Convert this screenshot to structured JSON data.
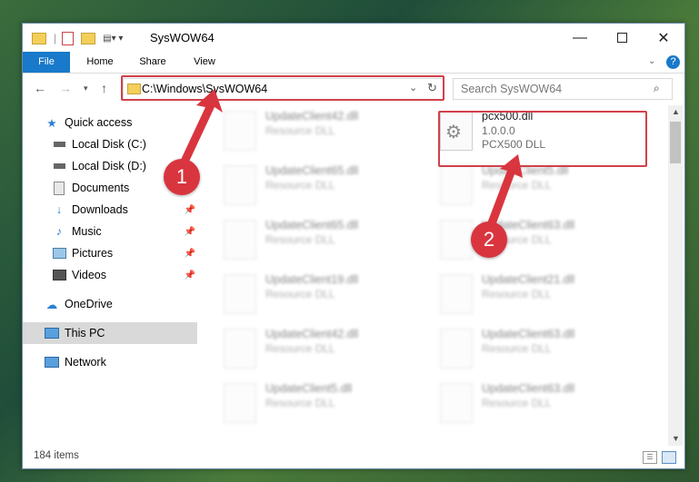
{
  "window": {
    "title": "SysWOW64"
  },
  "ribbon": {
    "tabs": [
      "File",
      "Home",
      "Share",
      "View"
    ]
  },
  "address": {
    "path": "C:\\Windows\\SysWOW64"
  },
  "search": {
    "placeholder": "Search SysWOW64"
  },
  "nav": {
    "items": [
      {
        "label": "Quick access",
        "icon": "star-icon"
      },
      {
        "label": "Local Disk (C:)",
        "icon": "drive-icon"
      },
      {
        "label": "Local Disk (D:)",
        "icon": "drive-icon"
      },
      {
        "label": "Documents",
        "icon": "documents-icon"
      },
      {
        "label": "Downloads",
        "icon": "download-icon"
      },
      {
        "label": "Music",
        "icon": "music-icon"
      },
      {
        "label": "Pictures",
        "icon": "pictures-icon"
      },
      {
        "label": "Videos",
        "icon": "videos-icon"
      },
      {
        "label": "OneDrive",
        "icon": "cloud-icon"
      },
      {
        "label": "This PC",
        "icon": "computer-icon"
      },
      {
        "label": "Network",
        "icon": "network-icon"
      }
    ]
  },
  "files": {
    "highlight": {
      "name": "pcx500.dll",
      "version": "1.0.0.0",
      "desc": "PCX500 DLL"
    },
    "left": [
      {
        "name": "UpdateClient42.dll",
        "desc": "Resource DLL"
      },
      {
        "name": "UpdateClient65.dll",
        "desc": "Resource DLL"
      },
      {
        "name": "UpdateClient65.dll",
        "desc": "Resource DLL"
      },
      {
        "name": "UpdateClient19.dll",
        "desc": "Resource DLL"
      },
      {
        "name": "UpdateClient42.dll",
        "desc": "Resource DLL"
      },
      {
        "name": "UpdateClient5.dll",
        "desc": "Resource DLL"
      }
    ],
    "right": [
      {
        "name": "UpdateClient5.dll",
        "desc": "Resource DLL"
      },
      {
        "name": "UpdateClient63.dll",
        "desc": "Resource DLL"
      },
      {
        "name": "UpdateClient21.dll",
        "desc": "Resource DLL"
      },
      {
        "name": "UpdateClient63.dll",
        "desc": "Resource DLL"
      },
      {
        "name": "UpdateClient63.dll",
        "desc": "Resource DLL"
      }
    ]
  },
  "status": {
    "count": "184 items"
  },
  "callouts": [
    "1",
    "2"
  ],
  "colors": {
    "accent": "#1979ca",
    "highlight": "#d0414a",
    "callout": "#d9353f"
  }
}
